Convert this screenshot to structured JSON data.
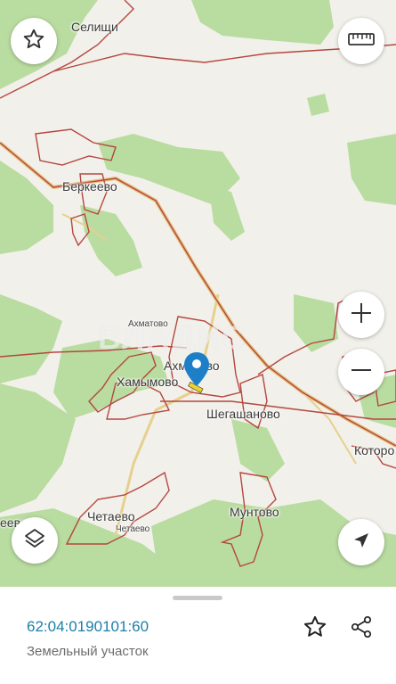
{
  "map": {
    "places": [
      {
        "name": "Селищи",
        "size": "normal"
      },
      {
        "name": "Беркеево",
        "size": "normal"
      },
      {
        "name": "Ахматово",
        "size": "small"
      },
      {
        "name": "Ахматово",
        "size": "normal"
      },
      {
        "name": "Хамымово",
        "size": "normal"
      },
      {
        "name": "Шегашаново",
        "size": "normal"
      },
      {
        "name": "Которо",
        "size": "normal"
      },
      {
        "name": "Мунтово",
        "size": "normal"
      },
      {
        "name": "Четаево",
        "size": "normal"
      },
      {
        "name": "Четаево",
        "size": "small"
      },
      {
        "name": "еево",
        "size": "normal"
      }
    ],
    "watermark": "ВЛАДИС",
    "colors": {
      "land": "#f2f0ea",
      "forest": "#b9dca0",
      "boundary": "#b5473f",
      "road": "#d9b26a",
      "marker": "#1e7fc9",
      "parcel": "#e8d23a"
    }
  },
  "controls": {
    "favorite_icon": "star-outline-icon",
    "ruler_icon": "ruler-icon",
    "zoom_in_icon": "plus-icon",
    "zoom_out_icon": "minus-icon",
    "layers_icon": "layers-icon",
    "locate_icon": "navigation-arrow-icon"
  },
  "info": {
    "cadastral_number": "62:04:0190101:60",
    "object_type": "Земельный участок",
    "actions": [
      "star-outline-icon",
      "share-icon"
    ]
  }
}
